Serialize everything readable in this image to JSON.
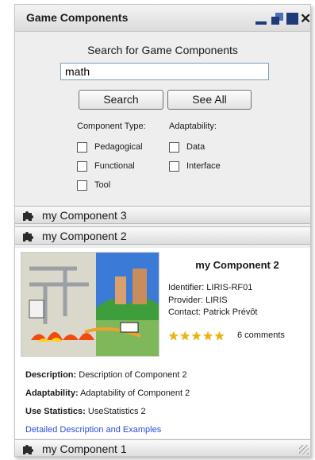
{
  "window": {
    "title": "Game Components",
    "buttons": {
      "minimize": "minimize",
      "restore": "restore",
      "maximize": "maximize",
      "close": "✕"
    }
  },
  "search": {
    "heading": "Search for Game Components",
    "value": "math",
    "search_label": "Search",
    "see_all_label": "See All"
  },
  "filters": {
    "component_type": {
      "heading": "Component Type:",
      "options": [
        {
          "label": "Pedagogical",
          "checked": false
        },
        {
          "label": "Functional",
          "checked": false
        },
        {
          "label": "Tool",
          "checked": false
        }
      ]
    },
    "adaptability": {
      "heading": "Adaptability:",
      "options": [
        {
          "label": "Data",
          "checked": false
        },
        {
          "label": "Interface",
          "checked": false
        }
      ]
    }
  },
  "components": [
    {
      "label": "my Component 3",
      "icon": "puzzle-icon",
      "expanded": false
    },
    {
      "label": "my Component 2",
      "icon": "puzzle-icon",
      "expanded": true
    },
    {
      "label": "my Component 1",
      "icon": "puzzle-icon",
      "expanded": false
    }
  ],
  "detail": {
    "title": "my Component 2",
    "identifier": "Identifier: LIRIS-RF01",
    "provider": "Provider: LIRIS",
    "contact": "Contact: Patrick Prévôt",
    "rating": 5,
    "comments": "6 comments",
    "description_label": "Description:",
    "description_value": " Description of Component 2",
    "adaptability_label": "Adaptability:",
    "adaptability_value": " Adaptability of Component 2",
    "use_stats_label": "Use Statistics:",
    "use_stats_value": " UseStatistics 2",
    "link_text": "Detailed Description and Examples"
  },
  "colors": {
    "link": "#2a4fd6",
    "window_button": "#1e3a78",
    "star": "#f0b400"
  }
}
